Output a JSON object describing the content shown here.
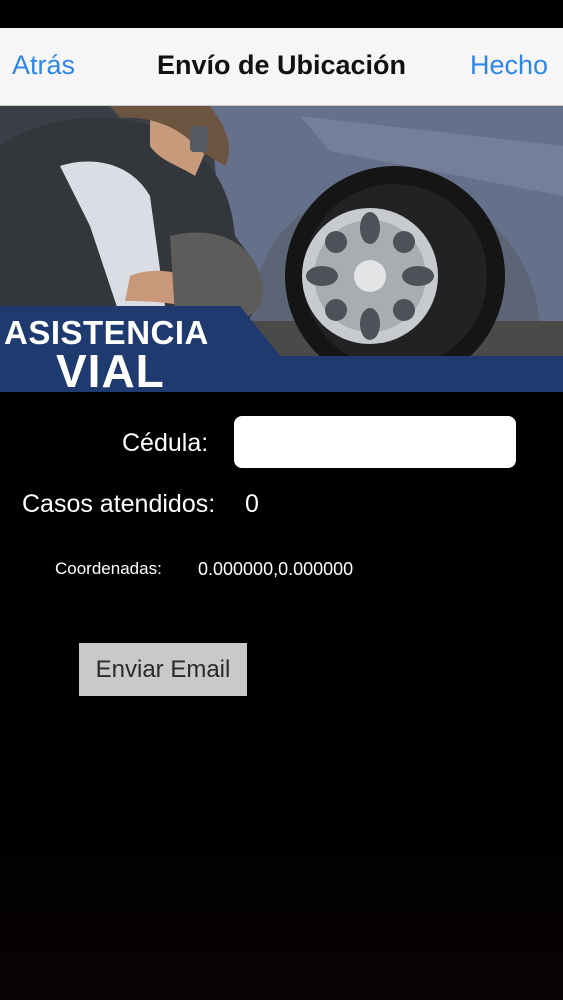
{
  "nav": {
    "back_label": "Atrás",
    "title": "Envío de Ubicación",
    "done_label": "Hecho"
  },
  "banner": {
    "line1": "ASISTENCIA",
    "line2": "VIAL",
    "accent_color": "#1e3a6e"
  },
  "form": {
    "cedula_label": "Cédula:",
    "cedula_value": "",
    "casos_label": "Casos atendidos:",
    "casos_value": "0",
    "coord_label": "Coordenadas:",
    "coord_value": "0.000000,0.000000",
    "send_button_label": "Enviar Email"
  },
  "colors": {
    "link": "#2f86e6",
    "nav_background": "#f6f6f6",
    "background": "#000000",
    "button_background": "#c9c9c9"
  }
}
